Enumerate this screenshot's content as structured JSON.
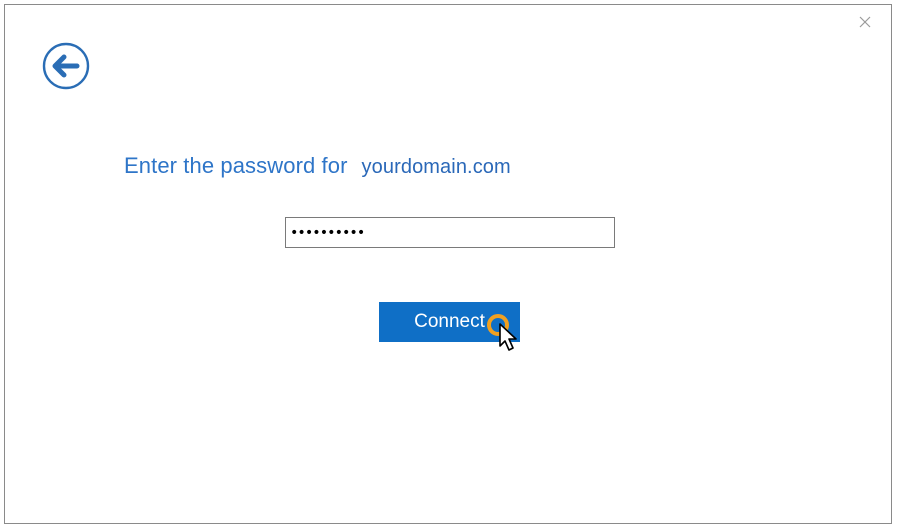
{
  "dialog": {
    "close_glyph": "×",
    "back_icon": "back-arrow-icon",
    "prompt_text": "Enter the password for",
    "domain": "yourdomain.com",
    "password_value": "••••••••••",
    "connect_label": "Connect"
  },
  "colors": {
    "accent": "#0f6fc6",
    "prompt_text": "#2e75c8",
    "icon_stroke": "#2a6db5",
    "click_highlight": "#f0a020"
  }
}
